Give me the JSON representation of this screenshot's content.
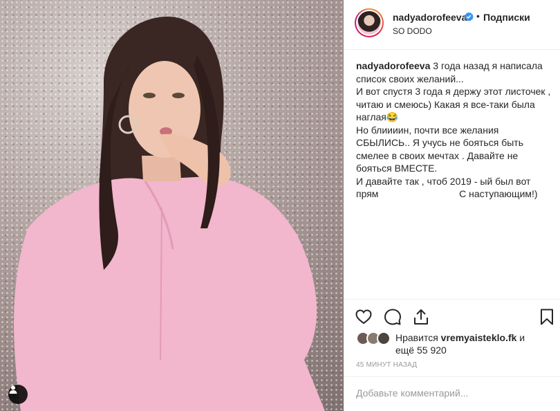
{
  "post": {
    "username": "nadyadorofeeva",
    "dot": "•",
    "follow_label": "Подписки",
    "location": "SO DODO",
    "caption_author": "nadyadorofeeva",
    "caption_text": " 3 года назад я написала список своих желаний...\nИ вот спустя 3 года я держу этот листочек , читаю и смеюсь) Какая я все-таки была наглая😂\nНо блиииин, почти все желания СБЫЛИСЬ.. Я учусь не бояться быть смелее в своих мечтах . Давайте не бояться ВМЕСТЕ.\nИ давайте так , чтоб 2019 - ый был вот прям                              С наступающим!)",
    "likes_prefix": "Нравится ",
    "likes_user": "vremyaisteklo.fk",
    "likes_suffix": " и",
    "likes_more": "ещё 55 920",
    "timestamp": "45 МИНУТ НАЗАД",
    "comment_placeholder": "Добавьте комментарий..."
  },
  "icons": {
    "verified": "verified-badge-icon",
    "like": "heart-icon",
    "comment": "comment-bubble-icon",
    "share": "share-icon",
    "save": "bookmark-icon",
    "user_tag": "user-tag-icon"
  },
  "colors": {
    "verified_blue": "#3897f0",
    "text": "#262626",
    "muted": "#999999",
    "border": "#efefef",
    "sweater_pink": "#f2b6cd"
  }
}
